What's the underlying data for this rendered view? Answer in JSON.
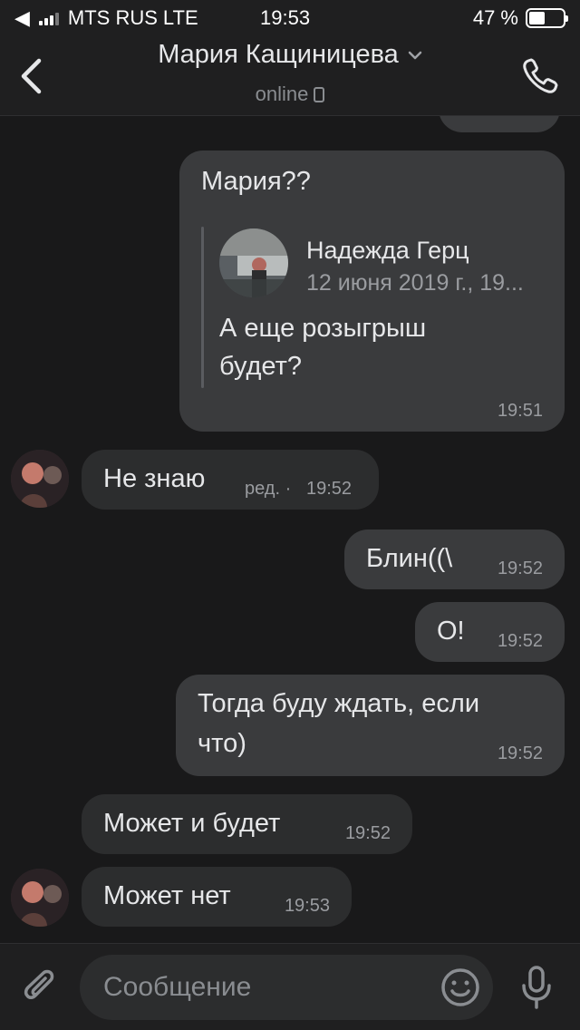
{
  "status_bar": {
    "back_label": "◀",
    "carrier": "MTS RUS",
    "network": "LTE",
    "time": "19:53",
    "battery": "47 %",
    "battery_level": 0.47
  },
  "header": {
    "contact_name": "Мария Кащиницева",
    "status": "online"
  },
  "messages": [
    {
      "text": "Мария??",
      "time": "19:51",
      "reply": {
        "author": "Надежда Герц",
        "date": "12 июня 2019 г., 19...",
        "text_line1": "А еще розыгрыш",
        "text_line2": "будет?"
      }
    },
    {
      "text": "Не знаю",
      "edited": "ред. ·",
      "time": "19:52"
    },
    {
      "text": "Блин((\\",
      "time": "19:52"
    },
    {
      "text": "О!",
      "time": "19:52"
    },
    {
      "text_line1": "Тогда буду ждать, если",
      "text_line2": "что)",
      "time": "19:52"
    },
    {
      "text": "Может и будет",
      "time": "19:52"
    },
    {
      "text": "Может нет",
      "time": "19:53"
    }
  ],
  "composer": {
    "placeholder": "Сообщение"
  },
  "colors": {
    "background": "#19191a",
    "bubble_in": "#2c2d2e",
    "bubble_out": "#3a3b3d",
    "text": "#e6e7e9",
    "muted": "#9a9ca0"
  }
}
